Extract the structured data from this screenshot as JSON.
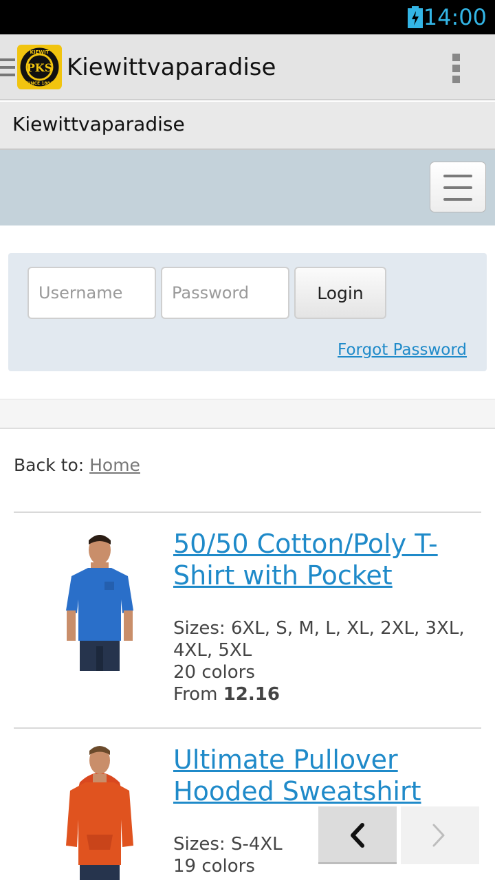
{
  "status_bar": {
    "time": "14:00",
    "icons": [
      "battery-charging-icon"
    ],
    "accent_color": "#33b5e5"
  },
  "app_bar": {
    "title": "Kiewittvaparadise",
    "logo": {
      "top_text": "KIEWIT",
      "initials": "PKS",
      "bottom_text": "SINCE 1884"
    },
    "icons": [
      "drawer-menu-icon",
      "overflow-menu-icon"
    ]
  },
  "site_header": {
    "title": "Kiewittvaparadise"
  },
  "nav": {
    "toggle_icon": "hamburger-icon"
  },
  "login": {
    "username_placeholder": "Username",
    "password_placeholder": "Password",
    "login_label": "Login",
    "forgot_label": "Forgot Password"
  },
  "breadcrumb": {
    "prefix": "Back to: ",
    "link_label": "Home"
  },
  "products": [
    {
      "title": "50/50 Cotton/Poly T-Shirt with Pocket",
      "sizes": "Sizes: 6XL, S, M, L, XL, 2XL, 3XL, 4XL, 5XL",
      "colors": "20 colors",
      "price_prefix": "From ",
      "price": "12.16",
      "image": "man-in-blue-tshirt"
    },
    {
      "title": "Ultimate Pullover Hooded Sweatshirt",
      "sizes": "Sizes: S-4XL",
      "colors": "19 colors",
      "image": "man-in-orange-hoodie"
    }
  ],
  "pager": {
    "icons": [
      "chevron-left-icon",
      "chevron-right-icon"
    ],
    "prev_state": "enabled",
    "next_state": "disabled"
  },
  "colors": {
    "link": "#1f8ac9",
    "nav_band": "#c4d2da",
    "login_panel": "#e2e9f0",
    "app_bar": "#e4e4e4"
  }
}
